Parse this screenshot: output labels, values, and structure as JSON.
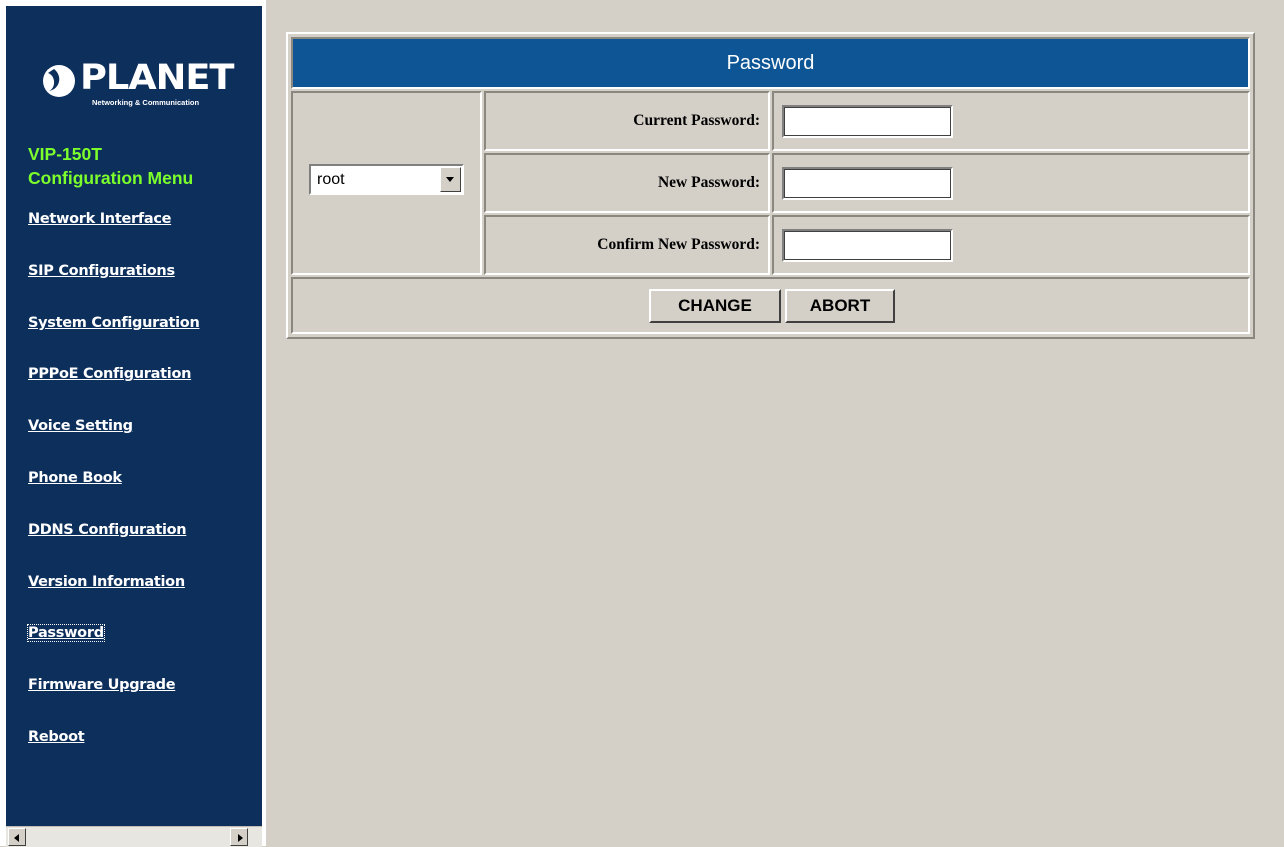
{
  "brand": {
    "logo_text": "PLANET",
    "tagline": "Networking & Communication"
  },
  "menu": {
    "title_line1": "VIP-150T",
    "title_line2": "Configuration Menu",
    "items": [
      {
        "label": "Network Interface"
      },
      {
        "label": "SIP Configurations"
      },
      {
        "label": "System Configuration"
      },
      {
        "label": "PPPoE Configuration"
      },
      {
        "label": "Voice Setting"
      },
      {
        "label": "Phone Book"
      },
      {
        "label": "DDNS Configuration"
      },
      {
        "label": "Version Information"
      },
      {
        "label": "Password",
        "active": true
      },
      {
        "label": "Firmware Upgrade"
      },
      {
        "label": "Reboot"
      }
    ]
  },
  "form": {
    "title": "Password",
    "user_select": {
      "value": "root"
    },
    "fields": [
      {
        "label": "Current Password:",
        "value": ""
      },
      {
        "label": "New Password:",
        "value": ""
      },
      {
        "label": "Confirm New Password:",
        "value": ""
      }
    ],
    "buttons": {
      "change": "CHANGE",
      "abort": "ABORT"
    }
  },
  "colors": {
    "sidebar_bg": "#0d2f5c",
    "menu_title": "#7cff2a",
    "header_bg": "#0d5594",
    "page_bg": "#d4d0c8"
  }
}
